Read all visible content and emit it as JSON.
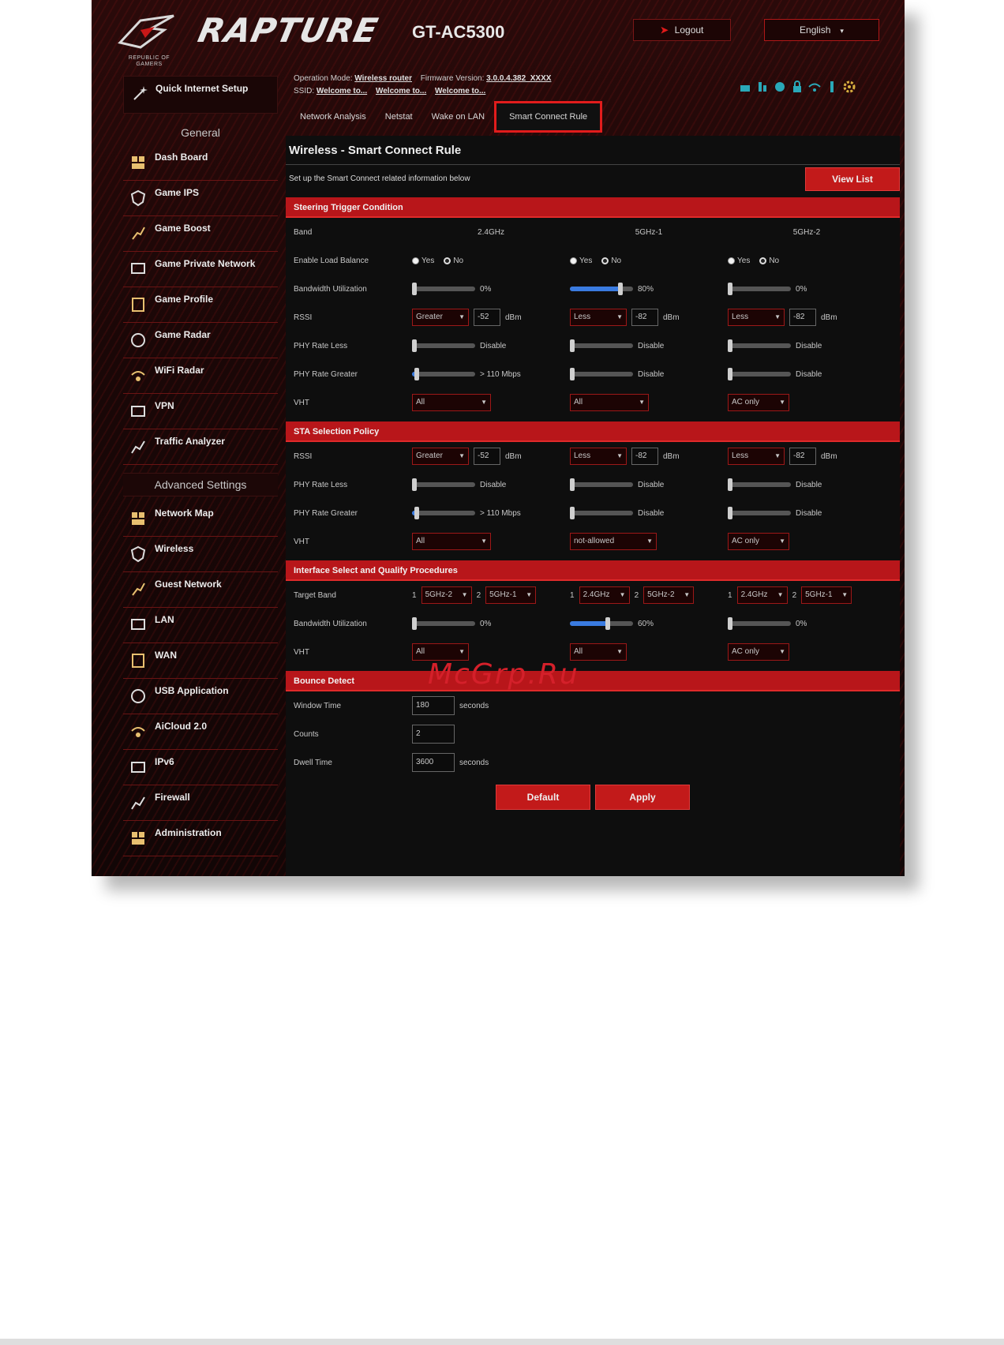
{
  "header": {
    "logo_text": "REPUBLIC OF GAMERS",
    "brand": "RAPTURE",
    "model": "GT-AC5300",
    "logout_label": "Logout",
    "language": "English"
  },
  "info": {
    "operation_mode_label": "Operation Mode:",
    "operation_mode": "Wireless router",
    "firmware_label": "Firmware Version:",
    "firmware": "3.0.0.4.382_XXXX",
    "ssid_label": "SSID:",
    "ssids": [
      "Welcome to...",
      "Welcome to...",
      "Welcome to..."
    ]
  },
  "tabs": [
    "Network Analysis",
    "Netstat",
    "Wake on LAN",
    "Smart Connect Rule"
  ],
  "sidebar": {
    "quick_setup": "Quick Internet Setup",
    "general_title": "General",
    "general_items": [
      "Dash Board",
      "Game IPS",
      "Game Boost",
      "Game Private Network",
      "Game Profile",
      "Game Radar",
      "WiFi Radar",
      "VPN",
      "Traffic Analyzer"
    ],
    "advanced_title": "Advanced Settings",
    "advanced_items": [
      "Network Map",
      "Wireless",
      "Guest Network",
      "LAN",
      "WAN",
      "USB Application",
      "AiCloud 2.0",
      "IPv6",
      "Firewall",
      "Administration"
    ]
  },
  "page": {
    "title": "Wireless - Smart Connect Rule",
    "description": "Set up the Smart Connect related information below",
    "view_list": "View List"
  },
  "steering": {
    "title": "Steering Trigger Condition",
    "band_label": "Band",
    "bands": [
      "2.4GHz",
      "5GHz-1",
      "5GHz-2"
    ],
    "load_balance_label": "Enable Load Balance",
    "yes": "Yes",
    "no": "No",
    "bw_label": "Bandwidth Utilization",
    "bw_values": [
      "0%",
      "80%",
      "0%"
    ],
    "bw_levels": [
      0,
      0.8,
      0
    ],
    "rssi_label": "RSSI",
    "rssi_ops": [
      "Greater",
      "Less",
      "Less"
    ],
    "rssi_values": [
      "-52",
      "-82",
      "-82"
    ],
    "dbm": "dBm",
    "phy_less_label": "PHY Rate Less",
    "phy_less": [
      "Disable",
      "Disable",
      "Disable"
    ],
    "phy_greater_label": "PHY Rate Greater",
    "phy_greater": [
      "> 110 Mbps",
      "Disable",
      "Disable"
    ],
    "phy_greater_levels": [
      0.08,
      0,
      0
    ],
    "vht_label": "VHT",
    "vht": [
      "All",
      "All",
      "AC only"
    ]
  },
  "sta": {
    "title": "STA Selection Policy",
    "rssi_label": "RSSI",
    "rssi_ops": [
      "Greater",
      "Less",
      "Less"
    ],
    "rssi_values": [
      "-52",
      "-82",
      "-82"
    ],
    "dbm": "dBm",
    "phy_less_label": "PHY Rate Less",
    "phy_less": [
      "Disable",
      "Disable",
      "Disable"
    ],
    "phy_greater_label": "PHY Rate Greater",
    "phy_greater": [
      "> 110 Mbps",
      "Disable",
      "Disable"
    ],
    "phy_greater_levels": [
      0.08,
      0,
      0
    ],
    "vht_label": "VHT",
    "vht": [
      "All",
      "not-allowed",
      "AC only"
    ]
  },
  "iface": {
    "title": "Interface Select and Qualify Procedures",
    "target_label": "Target Band",
    "targets": [
      [
        "1",
        "5GHz-2",
        "2",
        "5GHz-1"
      ],
      [
        "1",
        "2.4GHz",
        "2",
        "5GHz-2"
      ],
      [
        "1",
        "2.4GHz",
        "2",
        "5GHz-1"
      ]
    ],
    "bw_label": "Bandwidth Utilization",
    "bw_values": [
      "0%",
      "60%",
      "0%"
    ],
    "bw_levels": [
      0,
      0.6,
      0
    ],
    "vht_label": "VHT",
    "vht": [
      "All",
      "All",
      "AC only"
    ]
  },
  "bounce": {
    "title": "Bounce Detect",
    "window_label": "Window Time",
    "window_value": "180",
    "seconds": "seconds",
    "counts_label": "Counts",
    "counts_value": "2",
    "dwell_label": "Dwell Time",
    "dwell_value": "3600"
  },
  "buttons": {
    "default": "Default",
    "apply": "Apply"
  },
  "watermark": "McGrp.Ru",
  "colors": {
    "accent": "#b8161a",
    "highlight": "#e21c1c",
    "slider_fill": "#3a7be0"
  }
}
